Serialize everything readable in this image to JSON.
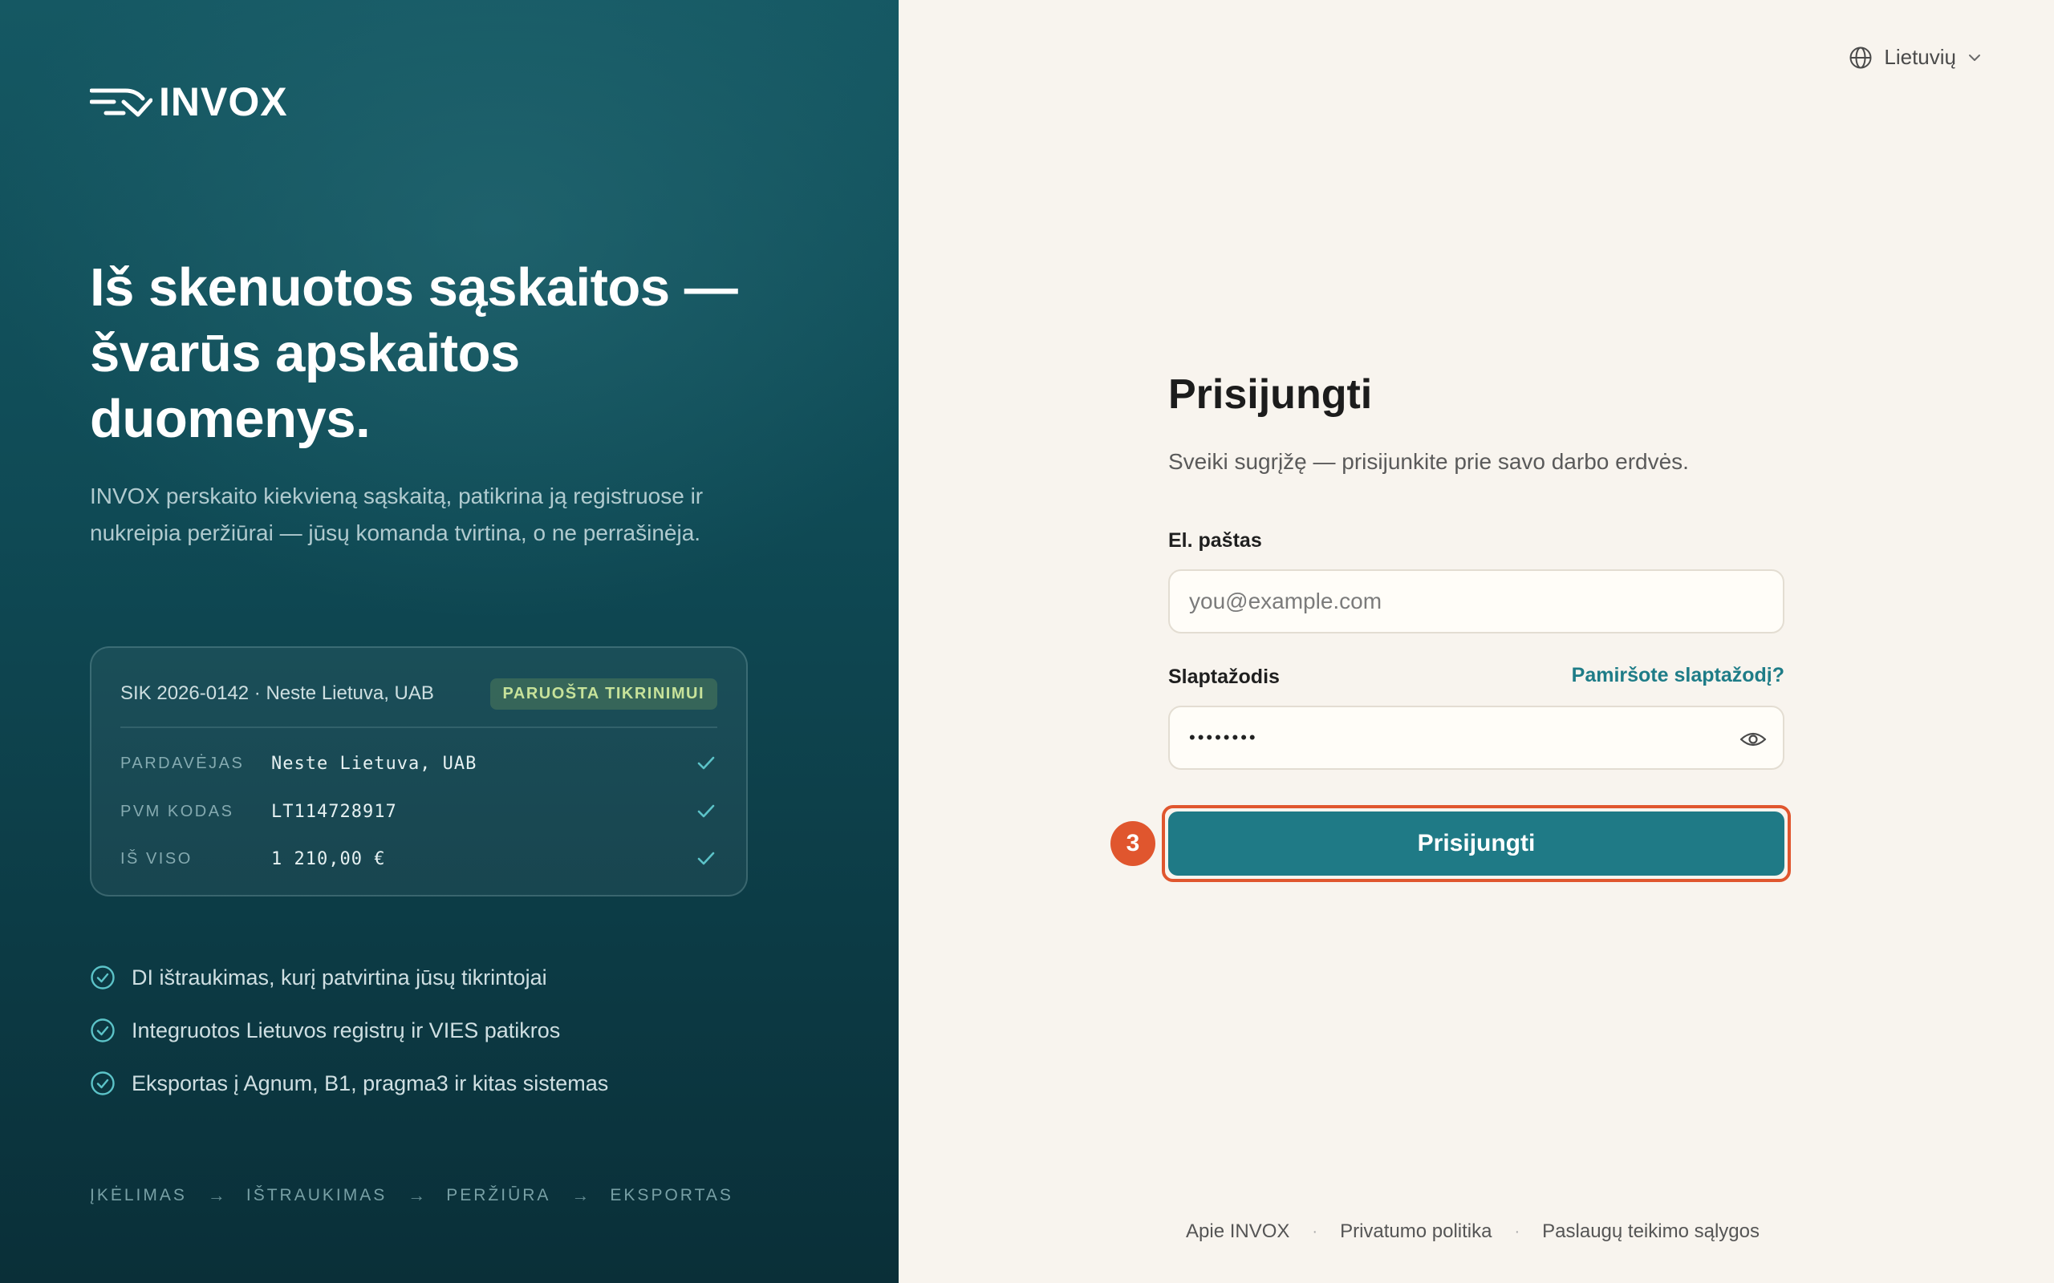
{
  "brand": {
    "name": "INVOX",
    "headline": [
      "Iš skenuotos sąskaitos —",
      "švarūs apskaitos",
      "duomenys."
    ],
    "lede": "INVOX perskaito kiekvieną sąskaitą, patikrina ją registruose ir nukreipia peržiūrai — jūsų komanda tvirtina, o ne perrašinėja."
  },
  "invoice_card": {
    "title": "SIK 2026-0142 · Neste Lietuva, UAB",
    "badge": "PARUOŠTA TIKRINIMUI",
    "rows": [
      {
        "key": "PARDAVĖJAS",
        "value": "Neste Lietuva, UAB",
        "status": "check-icon"
      },
      {
        "key": "PVM KODAS",
        "value": "LT114728917",
        "status": "check-icon"
      },
      {
        "key": "IŠ VISO",
        "value": "1 210,00 €",
        "status": "check-icon"
      }
    ]
  },
  "features": [
    "DI ištraukimas, kurį patvirtina jūsų tikrintojai",
    "Integruotos Lietuvos registrų ir VIES patikros",
    "Eksportas į Agnum, B1, pragma3 ir kitas sistemas"
  ],
  "pipeline": [
    "ĮKĖLIMAS",
    "IŠTRAUKIMAS",
    "PERŽIŪRA",
    "EKSPORTAS"
  ],
  "pipeline_arrow": "→",
  "language": {
    "label": "Lietuvių",
    "icon": "globe-icon"
  },
  "form": {
    "title": "Prisijungti",
    "subtitle": "Sveiki sugrįžę — prisijunkite prie savo darbo erdvės.",
    "email_label": "El. paštas",
    "email_placeholder": "you@example.com",
    "password_label": "Slaptažodis",
    "password_value": "••••••••",
    "forgot_link": "Pamiršote slaptažodį?",
    "submit_label": "Prisijungti",
    "step_marker": "3"
  },
  "footer": {
    "links": [
      "Apie INVOX",
      "Privatumo politika",
      "Paslaugų teikimo sąlygos"
    ],
    "separator": "·"
  },
  "colors": {
    "brand_teal": "#1f7a86",
    "panel_dark": "#0f4a55",
    "highlight": "#e0562e",
    "badge_green": "#c7e29a",
    "page_bg": "#f8f4ee"
  }
}
